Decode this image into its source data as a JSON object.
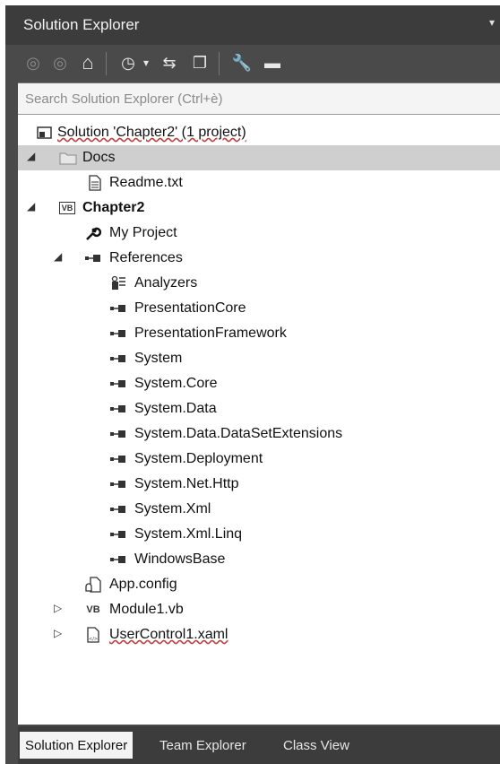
{
  "window": {
    "title": "Solution Explorer",
    "pin_glyph": "▾"
  },
  "toolbar": {
    "back_glyph": "◎",
    "forward_glyph": "◎",
    "home_glyph": "⌂",
    "history_glyph": "◷",
    "dropdown_glyph": "▾",
    "sync_glyph": "⇆",
    "pages_glyph": "❐",
    "properties_glyph": "🔧",
    "preview_glyph": "▬"
  },
  "search": {
    "placeholder": "Search Solution Explorer (Ctrl+è)"
  },
  "tree": {
    "solution": {
      "label": "Solution 'Chapter2' (1 project)"
    },
    "docs": {
      "label": "Docs",
      "caret": "◢"
    },
    "readme": {
      "label": "Readme.txt"
    },
    "project": {
      "label": "Chapter2",
      "badge": "VB",
      "caret": "◢"
    },
    "my_project": {
      "label": "My Project"
    },
    "references": {
      "label": "References",
      "caret": "◢"
    },
    "analyzers": {
      "label": "Analyzers"
    },
    "refs": [
      "PresentationCore",
      "PresentationFramework",
      "System",
      "System.Core",
      "System.Data",
      "System.Data.DataSetExtensions",
      "System.Deployment",
      "System.Net.Http",
      "System.Xml",
      "System.Xml.Linq",
      "WindowsBase"
    ],
    "app_config": {
      "label": "App.config"
    },
    "module1": {
      "label": "Module1.vb",
      "badge": "VB",
      "caret": "▷"
    },
    "usercontrol": {
      "label": "UserControl1.xaml",
      "caret": "▷"
    }
  },
  "tabs": [
    "Solution Explorer",
    "Team Explorer",
    "Class View"
  ],
  "colors": {
    "title_bg": "#3c3c3c",
    "toolbar_bg": "#4a4a4a",
    "selection": "#cfcfcf",
    "tab_bg": "#3c3c3c"
  }
}
